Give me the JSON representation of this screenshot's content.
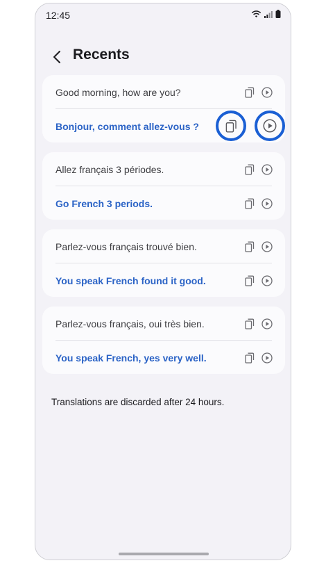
{
  "status_bar": {
    "time": "12:45"
  },
  "header": {
    "title": "Recents"
  },
  "cards": [
    {
      "source": "Good morning, how are you?",
      "translation": "Bonjour, comment allez-vous ?"
    },
    {
      "source": "Allez français 3 périodes.",
      "translation": "Go French 3 periods."
    },
    {
      "source": "Parlez-vous français trouvé bien.",
      "translation": "You speak French found it good."
    },
    {
      "source": "Parlez-vous français, oui très bien.",
      "translation": "You speak French, yes very well."
    }
  ],
  "footer": {
    "note": "Translations are discarded after 24 hours."
  },
  "colors": {
    "accent": "#2b63c6",
    "highlight": "#1a5fd4",
    "background": "#f3f2f7",
    "card": "#fbfbfd"
  },
  "icons": {
    "copy": "copy-icon",
    "play": "play-icon",
    "back": "back-arrow-icon"
  }
}
